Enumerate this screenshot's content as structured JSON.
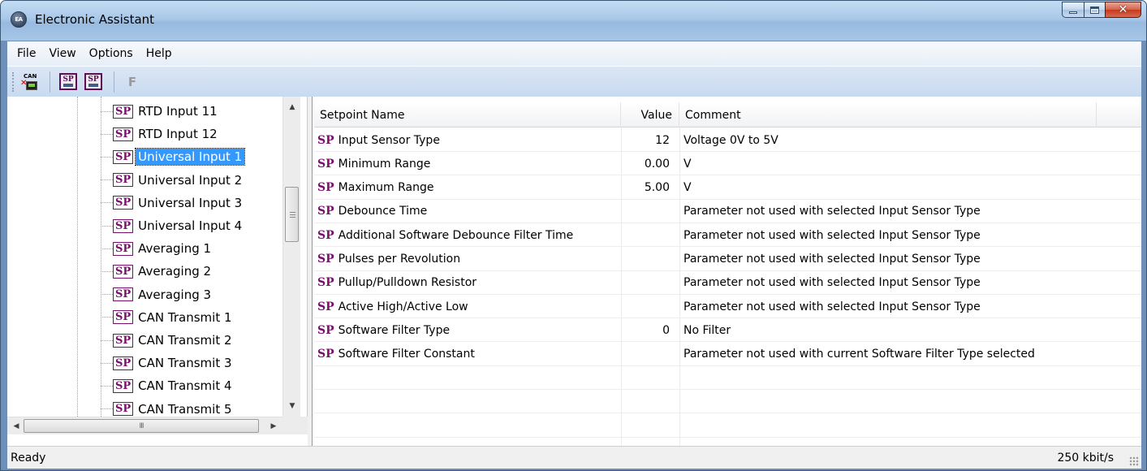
{
  "window": {
    "title": "Electronic Assistant",
    "icon": "ea-logo-icon"
  },
  "menu": [
    "File",
    "View",
    "Options",
    "Help"
  ],
  "toolbar": {
    "can_label": "CAN",
    "sp_label": "SP",
    "f_label": "F"
  },
  "tree": {
    "badge": "SP",
    "items": [
      {
        "label": "RTD Input 11",
        "selected": false
      },
      {
        "label": "RTD Input 12",
        "selected": false
      },
      {
        "label": "Universal Input 1",
        "selected": true
      },
      {
        "label": "Universal Input 2",
        "selected": false
      },
      {
        "label": "Universal Input 3",
        "selected": false
      },
      {
        "label": "Universal Input 4",
        "selected": false
      },
      {
        "label": "Averaging 1",
        "selected": false
      },
      {
        "label": "Averaging 2",
        "selected": false
      },
      {
        "label": "Averaging 3",
        "selected": false
      },
      {
        "label": "CAN Transmit 1",
        "selected": false
      },
      {
        "label": "CAN Transmit 2",
        "selected": false
      },
      {
        "label": "CAN Transmit 3",
        "selected": false
      },
      {
        "label": "CAN Transmit 4",
        "selected": false
      },
      {
        "label": "CAN Transmit 5",
        "selected": false
      }
    ],
    "hscroll_thumb_text": "III"
  },
  "grid": {
    "headers": [
      "Setpoint Name",
      "Value",
      "Comment"
    ],
    "badge": "SP",
    "rows": [
      {
        "name": "Input Sensor Type",
        "value": "12",
        "comment": "Voltage 0V to 5V"
      },
      {
        "name": "Minimum Range",
        "value": "0.00",
        "comment": "V"
      },
      {
        "name": "Maximum Range",
        "value": "5.00",
        "comment": "V"
      },
      {
        "name": "Debounce Time",
        "value": "",
        "comment": "Parameter not used with selected Input Sensor Type"
      },
      {
        "name": "Additional Software Debounce Filter Time",
        "value": "",
        "comment": "Parameter not used with selected Input Sensor Type"
      },
      {
        "name": "Pulses per Revolution",
        "value": "",
        "comment": "Parameter not used with selected Input Sensor Type"
      },
      {
        "name": "Pullup/Pulldown Resistor",
        "value": "",
        "comment": "Parameter not used with selected Input Sensor Type"
      },
      {
        "name": "Active High/Active Low",
        "value": "",
        "comment": "Parameter not used with selected Input Sensor Type"
      },
      {
        "name": "Software Filter Type",
        "value": "0",
        "comment": "No Filter"
      },
      {
        "name": "Software Filter Constant",
        "value": "",
        "comment": "Parameter not used with current Software Filter Type selected"
      }
    ],
    "empty_rows": 3
  },
  "status": {
    "left": "Ready",
    "right": "250 kbit/s"
  },
  "colors": {
    "sp_badge": "#7b0e6f",
    "selection": "#3399ff",
    "titlebar": "#a9c8e8"
  }
}
